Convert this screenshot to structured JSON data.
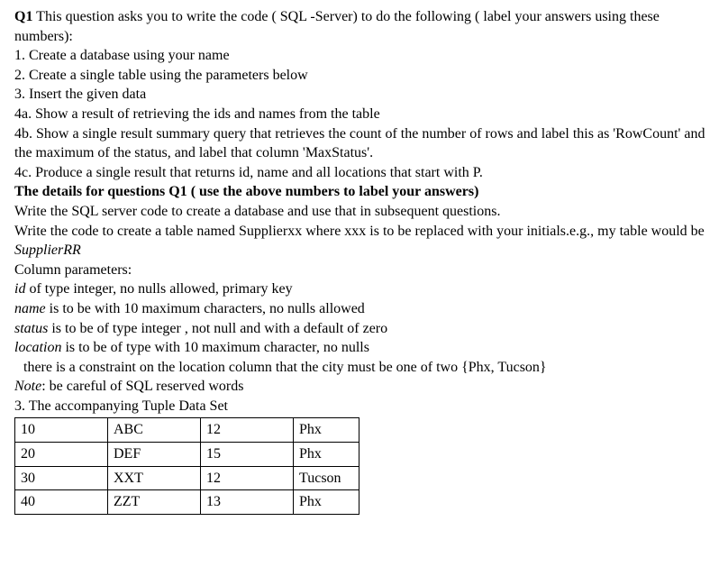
{
  "q1_label": "Q1",
  "q1_intro": " This question asks you to write the code ( SQL -Server) to do the following ( label your answers using these numbers):",
  "items": {
    "i1": "1. Create a database using your name",
    "i2": "2. Create a single  table using the parameters below",
    "i3": "3. Insert the given data",
    "i4a": "4a. Show a result of retrieving  the ids and names from the table",
    "i4b": "4b. Show a single result summary query that retrieves the count of the number of rows and label this as 'RowCount' and the maximum of the status, and label that column 'MaxStatus'.",
    "i4c": "4c. Produce a single result that returns id, name and all locations that start with P."
  },
  "details_heading": "The details for questions Q1 ( use the above numbers to label your answers)",
  "detail_lines": {
    "d1": "Write the SQL server code to create a database and use that in subsequent questions.",
    "d2a": "Write the code to create a table named Supplierxx where xxx is to be replaced with your initials.e.g., my table would be ",
    "d2b": "SupplierRR",
    "d3": "Column parameters:",
    "d4a": "id",
    "d4b": " of type integer, no nulls allowed, primary key",
    "d5a": "name",
    "d5b": " is to be with 10 maximum characters, no nulls allowed",
    "d6a": "status",
    "d6b": " is to be of type integer , not null and with a default of zero",
    "d7a": "location",
    "d7b": " is to be of type  with 10 maximum character, no nulls",
    "d8": "there is a constraint on the location column that the city must be one of two {Phx, Tucson}",
    "d9a": "Note",
    "d9b": ": be careful of SQL reserved words",
    "d10": "3. The accompanying Tuple Data Set"
  },
  "table": {
    "rows": [
      {
        "c1": "10",
        "c2": "ABC",
        "c3": "12",
        "c4": "Phx"
      },
      {
        "c1": "20",
        "c2": "DEF",
        "c3": "15",
        "c4": "Phx"
      },
      {
        "c1": "30",
        "c2": "XXT",
        "c3": "12",
        "c4": "Tucson"
      },
      {
        "c1": "40",
        "c2": "ZZT",
        "c3": "13",
        "c4": "Phx"
      }
    ]
  }
}
